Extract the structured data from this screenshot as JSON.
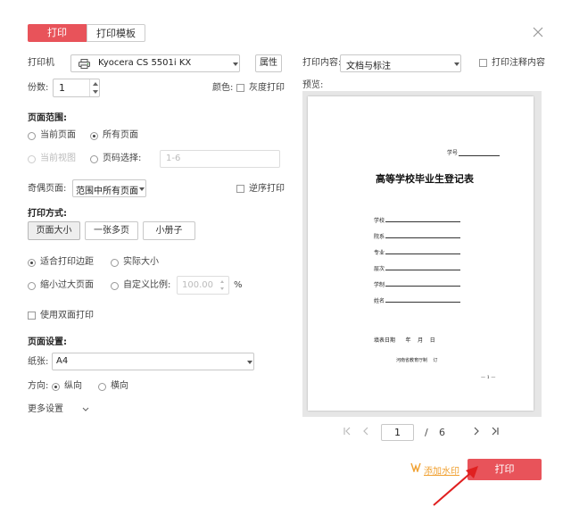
{
  "tabs": {
    "print": "打印",
    "print_template": "打印模板"
  },
  "printer": {
    "label": "打印机",
    "value": "Kyocera CS 5501i KX",
    "properties": "属性"
  },
  "content": {
    "label": "打印内容:",
    "value": "文档与标注",
    "annot_label": "打印注释内容"
  },
  "copies": {
    "label": "份数:",
    "value": "1"
  },
  "color": {
    "label": "颜色:",
    "grayscale": "灰度打印"
  },
  "preview": {
    "label": "预览:"
  },
  "page_range": {
    "title": "页面范围:",
    "current_page": "当前页面",
    "all_pages": "所有页面",
    "current_view": "当前视图",
    "page_select": "页码选择:",
    "page_select_placeholder": "1-6"
  },
  "odd_even": {
    "label": "奇偶页面:",
    "value": "范围中所有页面",
    "reverse": "逆序打印"
  },
  "print_mode": {
    "title": "打印方式:",
    "modes": [
      "页面大小",
      "一张多页",
      "小册子"
    ]
  },
  "scaling": {
    "fit_margins": "适合打印边距",
    "actual_size": "实际大小",
    "shrink_large": "缩小过大页面",
    "custom_scale": "自定义比例:",
    "custom_value": "100.00",
    "percent": "%"
  },
  "duplex": {
    "label": "使用双面打印"
  },
  "page_setup": {
    "title": "页面设置:",
    "paper_label": "纸张:",
    "paper_value": "A4",
    "orientation_label": "方向:",
    "portrait": "纵向",
    "landscape": "横向",
    "more": "更多设置"
  },
  "document": {
    "number_label": "学号",
    "title": "高等学校毕业生登记表",
    "fields": [
      "学校",
      "院系",
      "专业",
      "层次",
      "学制",
      "姓名"
    ],
    "date_line": "填表日期      年    月    日",
    "issuer": "河南省教育厅制    订",
    "page_mark": "— 1 —"
  },
  "pagination": {
    "current": "1",
    "separator": "/",
    "total": "6"
  },
  "footer": {
    "watermark": "添加水印",
    "print_button": "打印"
  },
  "colors": {
    "accent": "#e8535a",
    "watermark": "#f0a030"
  }
}
